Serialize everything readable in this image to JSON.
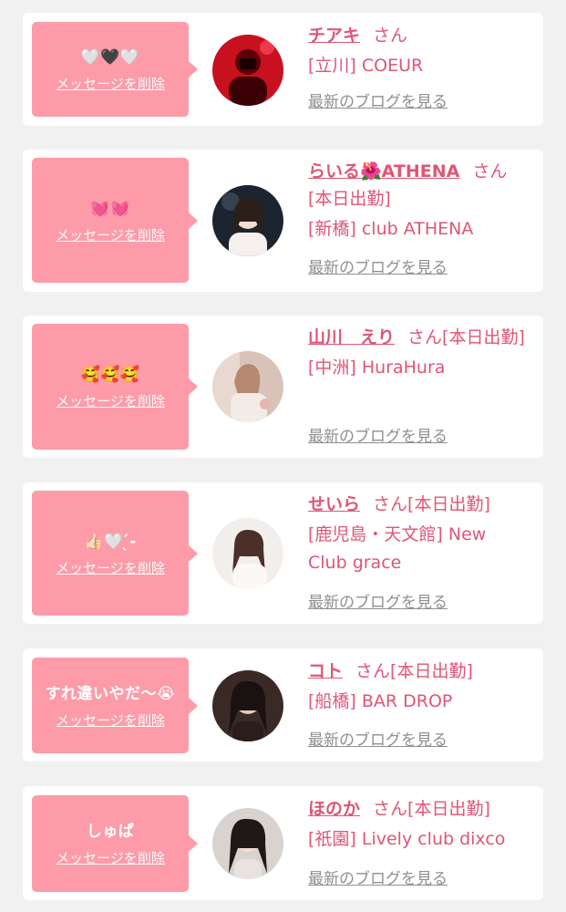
{
  "delete_label": "メッセージを削除",
  "san_label": "さん",
  "blog_label": "最新のブログを見る",
  "cards": [
    {
      "message": "🤍🖤🤍",
      "name": "チアキ",
      "status": "",
      "shop": "[立川] COEUR"
    },
    {
      "message": "💓💓",
      "name": "らいる🌺ATHENA",
      "status": "[本日出勤]",
      "shop": "[新橋] club ATHENA"
    },
    {
      "message": "🥰🥰🥰",
      "name": "山川　えり",
      "status": "[本日出勤]",
      "shop": "[中洲] HuraHura"
    },
    {
      "message": "👍🏻🤍 ̖́-",
      "name": "せいら",
      "status": "[本日出勤]",
      "shop": "[鹿児島・天文館] New Club grace"
    },
    {
      "message": "すれ違いやだ〜😭",
      "name": "コト",
      "status": "[本日出勤]",
      "shop": "[船橋] BAR DROP"
    },
    {
      "message": "しゅぱ",
      "name": "ほのか",
      "status": "[本日出勤]",
      "shop": "[祇園] Lively club dixco"
    }
  ]
}
